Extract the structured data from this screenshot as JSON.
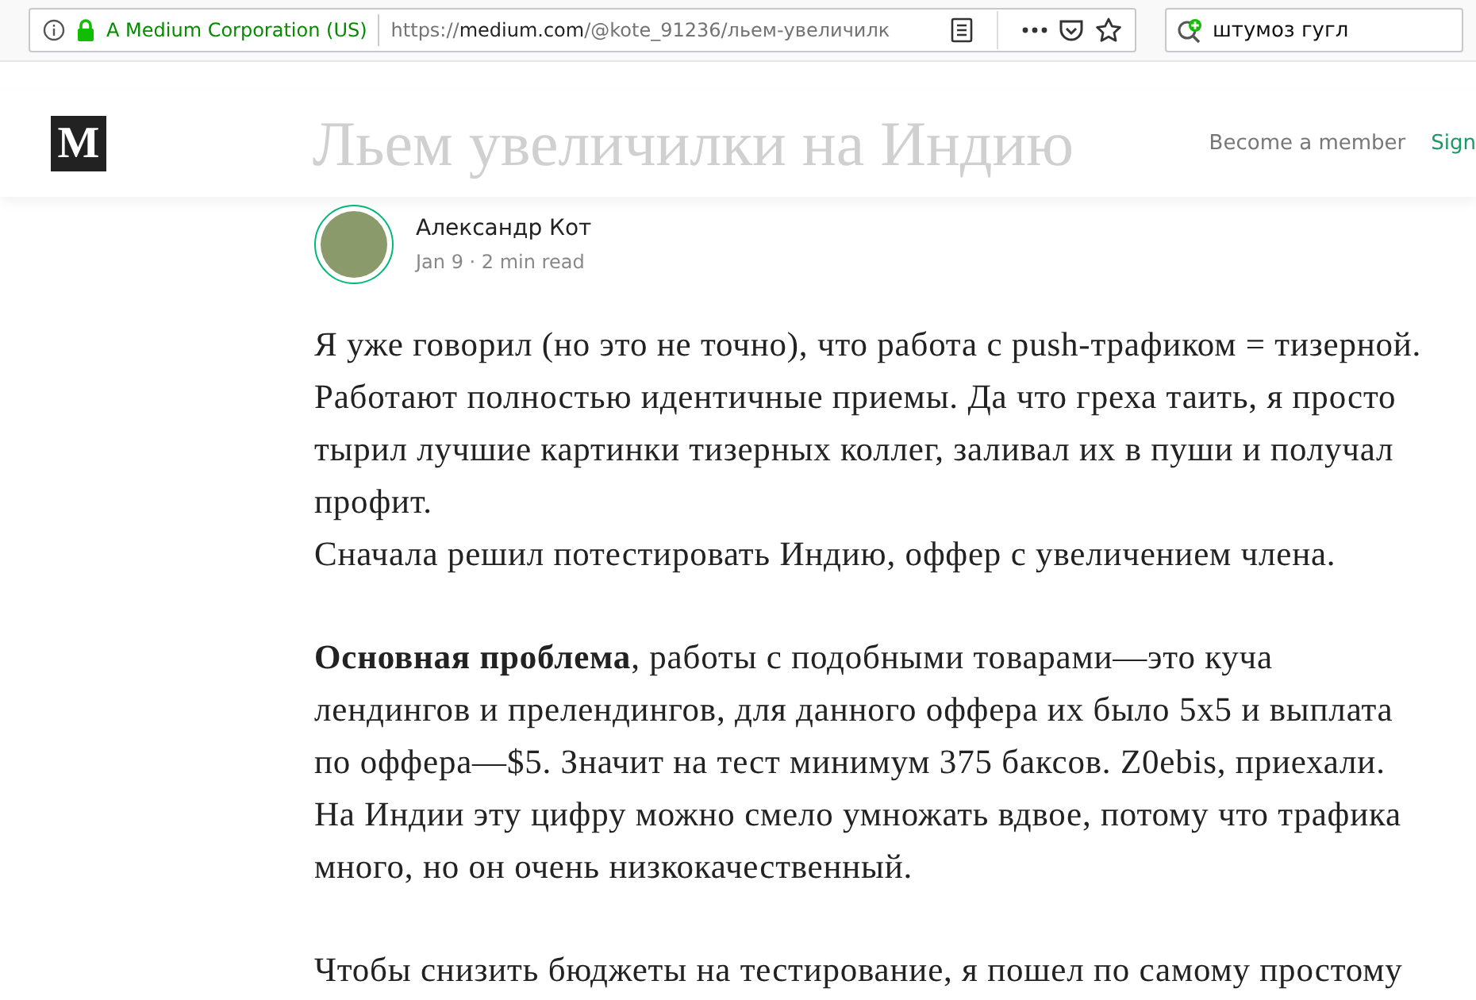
{
  "browser": {
    "identity": "A Medium Corporation (US)",
    "url_prefix": "https://",
    "url_domain": "medium.com",
    "url_path": "/@kote_91236/льем-увеличилк",
    "search_value": "штумоз гугл"
  },
  "header": {
    "logo": "M",
    "faded_title": "Льем увеличилки на Индию",
    "become_member": "Become a member",
    "sign": "Sign"
  },
  "author": {
    "name": "Александр Кот",
    "meta": "Jan 9 · 2 min read"
  },
  "paragraphs": [
    "Я уже говорил (но это не точно), что работа с push-трафиком = тизерной. Работают полностью идентичные приемы. Да что греха таить, я просто тырил лучшие картинки тизерных коллег, заливал их в пуши и получал профит.",
    "Сначала решил потестировать Индию, оффер с увеличением члена.",
    "**Основная проблема**, работы с подобными товарами—это куча лендингов и прелендингов, для данного оффера их было 5х5 и выплата по оффера—$5. Значит на тест минимум 375 баксов. Z0ebis, приехали. На Индии эту цифру можно смело умножать вдвое, потому что трафика много, но он очень низкокачественный.",
    "Чтобы снизить бюджеты на тестирование, я пошел по самому простому"
  ]
}
